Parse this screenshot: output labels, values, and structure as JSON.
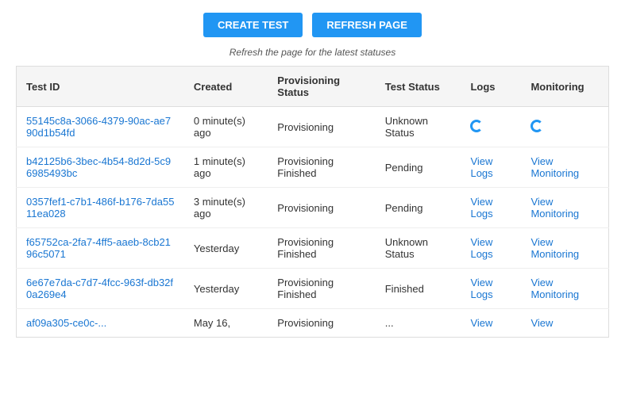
{
  "toolbar": {
    "create_label": "CREATE TEST",
    "refresh_label": "REFRESH PAGE",
    "note": "Refresh the page for the latest statuses"
  },
  "table": {
    "headers": [
      "Test ID",
      "Created",
      "Provisioning Status",
      "Test Status",
      "Logs",
      "Monitoring"
    ],
    "rows": [
      {
        "id": "55145c8a-3066-4379-90ac-ae790d1b54fd",
        "created": "0 minute(s) ago",
        "provisioning_status": "Provisioning",
        "test_status": "Unknown Status",
        "logs": "spinner",
        "monitoring": "spinner"
      },
      {
        "id": "b42125b6-3bec-4b54-8d2d-5c96985493bc",
        "created": "1 minute(s) ago",
        "provisioning_status": "Provisioning Finished",
        "test_status": "Pending",
        "logs": "View Logs",
        "monitoring": "View Monitoring"
      },
      {
        "id": "0357fef1-c7b1-486f-b176-7da5511ea028",
        "created": "3 minute(s) ago",
        "provisioning_status": "Provisioning",
        "test_status": "Pending",
        "logs": "View Logs",
        "monitoring": "View Monitoring"
      },
      {
        "id": "f65752ca-2fa7-4ff5-aaeb-8cb2196c5071",
        "created": "Yesterday",
        "provisioning_status": "Provisioning Finished",
        "test_status": "Unknown Status",
        "logs": "View Logs",
        "monitoring": "View Monitoring"
      },
      {
        "id": "6e67e7da-c7d7-4fcc-963f-db32f0a269e4",
        "created": "Yesterday",
        "provisioning_status": "Provisioning Finished",
        "test_status": "Finished",
        "logs": "View Logs",
        "monitoring": "View Monitoring"
      },
      {
        "id": "af09a305-ce0c-...",
        "created": "May 16,",
        "provisioning_status": "Provisioning",
        "test_status": "...",
        "logs": "View",
        "monitoring": "View"
      }
    ]
  }
}
